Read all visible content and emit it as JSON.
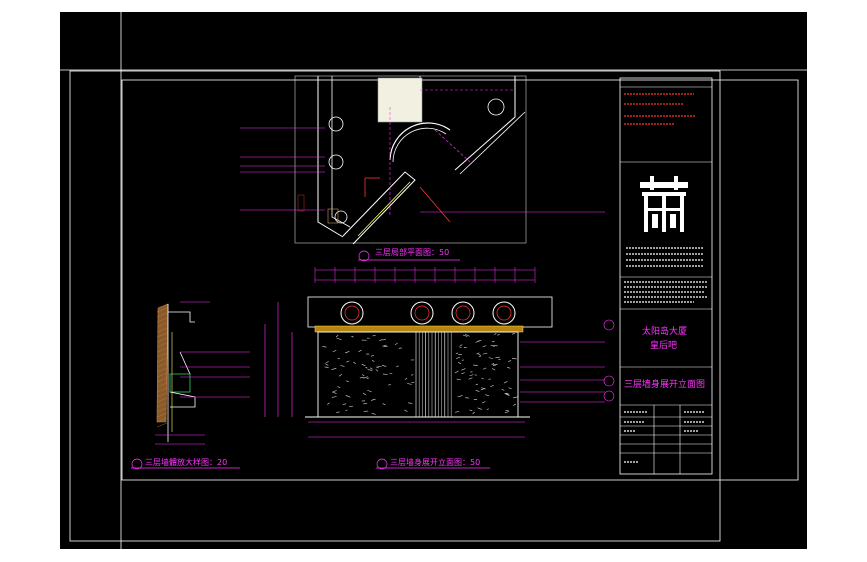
{
  "views": {
    "plan_title": "三层局部平面图：50",
    "elevation_title": "三层墙身展开立面图：50",
    "section_title": "三层墙體放大样图：20"
  },
  "title_block": {
    "project_lines": [
      "太阳岛大厦",
      "皇后吧"
    ],
    "drawing_title": "三层墙身展开立面图"
  },
  "colors": {
    "background": "#000000",
    "dimension": "#ff33ff",
    "note_red": "#ff3333",
    "line_white": "#ffffff",
    "hatch_brown": "#8b5a2b",
    "cabinet_green": "#33cc66",
    "cyan": "#00ffff"
  }
}
